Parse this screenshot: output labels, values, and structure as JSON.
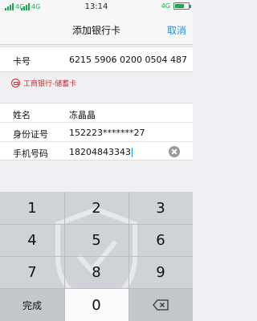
{
  "status": {
    "carrier_left": "4G",
    "carrier_right": "4G",
    "time": "13:14",
    "wifi_label": "4G",
    "battery_level": 0.7
  },
  "nav": {
    "title": "添加银行卡",
    "cancel_label": "取消"
  },
  "card": {
    "label": "卡号",
    "number": "6215 5906 0200 0504 487"
  },
  "bank_hint": "工商银行-储蓄卡",
  "info": {
    "name_label": "姓名",
    "name_value": "冻晶晶",
    "id_label": "身份证号",
    "id_value": "152223*******27",
    "phone_label": "手机号码",
    "phone_value": "18204843343"
  },
  "keyboard": {
    "k1": "1",
    "k2": "2",
    "k3": "3",
    "k4": "4",
    "k5": "5",
    "k6": "6",
    "k7": "7",
    "k8": "8",
    "k9": "9",
    "done": "完成",
    "k0": "0",
    "backspace_icon": "backspace-icon"
  }
}
